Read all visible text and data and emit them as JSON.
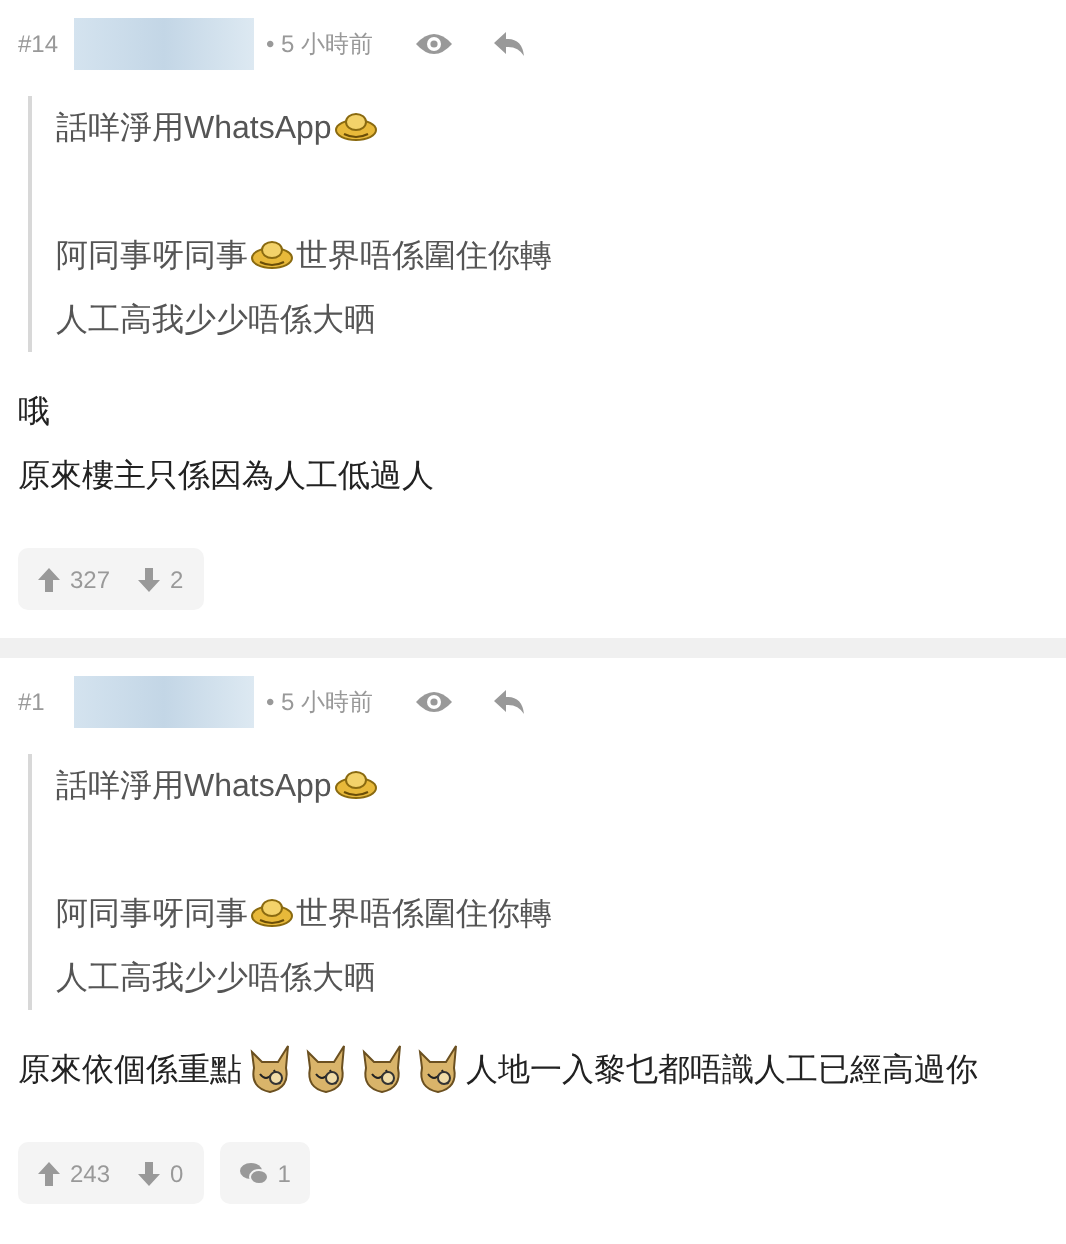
{
  "posts": [
    {
      "number": "#14",
      "time": "• 5 小時前",
      "quote": [
        [
          [
            {
              "kind": "text",
              "text": "話咩淨用WhatsApp"
            },
            {
              "kind": "duck"
            }
          ]
        ],
        [
          [
            {
              "kind": "text",
              "text": "阿同事呀同事"
            },
            {
              "kind": "duck"
            },
            {
              "kind": "text",
              "text": "世界唔係圍住你轉"
            }
          ],
          [
            {
              "kind": "text",
              "text": "人工高我少少唔係大晒"
            }
          ]
        ]
      ],
      "body": [
        [
          {
            "kind": "text",
            "text": "哦"
          }
        ],
        [
          {
            "kind": "text",
            "text": "原來樓主只係因為人工低過人"
          }
        ]
      ],
      "upvotes": "327",
      "downvotes": "2"
    },
    {
      "number": "#1",
      "time": "• 5 小時前",
      "quote": [
        [
          [
            {
              "kind": "text",
              "text": "話咩淨用WhatsApp"
            },
            {
              "kind": "duck"
            }
          ]
        ],
        [
          [
            {
              "kind": "text",
              "text": "阿同事呀同事"
            },
            {
              "kind": "duck"
            },
            {
              "kind": "text",
              "text": "世界唔係圍住你轉"
            }
          ],
          [
            {
              "kind": "text",
              "text": "人工高我少少唔係大晒"
            }
          ]
        ]
      ],
      "body": [
        [
          {
            "kind": "text",
            "text": "原來依個係重點"
          },
          {
            "kind": "cat"
          },
          {
            "kind": "cat"
          },
          {
            "kind": "cat"
          },
          {
            "kind": "cat"
          },
          {
            "kind": "text",
            "text": "人地一入黎乜都唔識人工已經高過你"
          }
        ]
      ],
      "upvotes": "243",
      "downvotes": "0",
      "replies": "1"
    }
  ]
}
